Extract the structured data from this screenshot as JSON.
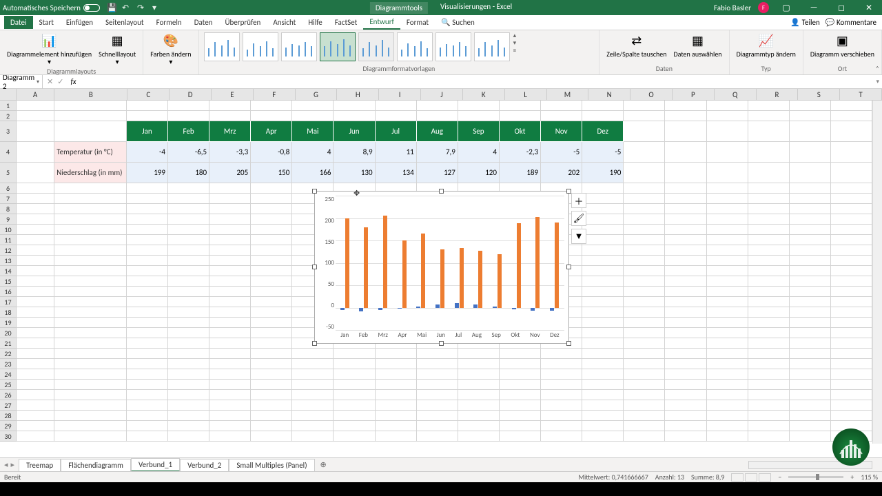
{
  "titlebar": {
    "autosave": "Automatisches Speichern",
    "app_title": "Visualisierungen - Excel",
    "tool_context": "Diagrammtools",
    "user": "Fabio Basler",
    "user_initials": "F"
  },
  "ribbon_tabs": [
    "Datei",
    "Start",
    "Einfügen",
    "Seitenlayout",
    "Formeln",
    "Daten",
    "Überprüfen",
    "Ansicht",
    "Hilfe",
    "FactSet",
    "Entwurf",
    "Format"
  ],
  "ribbon_search": "Suchen",
  "ribbon_actions": {
    "share": "Teilen",
    "comments": "Kommentare"
  },
  "ribbon": {
    "group_layouts": "Diagrammlayouts",
    "btn_add_element": "Diagrammelement hinzufügen",
    "btn_quick_layout": "Schnelllayout",
    "btn_colors": "Farben ändern",
    "group_styles": "Diagrammformatvorlagen",
    "group_data": "Daten",
    "btn_switch": "Zeile/Spalte tauschen",
    "btn_select": "Daten auswählen",
    "group_type": "Typ",
    "btn_change_type": "Diagrammtyp ändern",
    "group_location": "Ort",
    "btn_move": "Diagramm verschieben"
  },
  "namebox": "Diagramm 2",
  "columns": [
    "A",
    "B",
    "C",
    "D",
    "E",
    "F",
    "G",
    "H",
    "I",
    "J",
    "K",
    "L",
    "M",
    "N",
    "O",
    "P",
    "Q",
    "R",
    "S",
    "T"
  ],
  "months": [
    "Jan",
    "Feb",
    "Mrz",
    "Apr",
    "Mai",
    "Jun",
    "Jul",
    "Aug",
    "Sep",
    "Okt",
    "Nov",
    "Dez"
  ],
  "row_labels": {
    "temp": "Temperatur (in °C)",
    "precip": "Niederschlag (in mm)"
  },
  "temp": [
    "-4",
    "-6,5",
    "-3,3",
    "-0,8",
    "4",
    "8,9",
    "11",
    "7,9",
    "4",
    "-2,3",
    "-5",
    "-5"
  ],
  "precip": [
    "199",
    "180",
    "205",
    "150",
    "166",
    "130",
    "134",
    "127",
    "120",
    "189",
    "202",
    "190"
  ],
  "chart_data": {
    "type": "bar",
    "categories": [
      "Jan",
      "Feb",
      "Mrz",
      "Apr",
      "Mai",
      "Jun",
      "Jul",
      "Aug",
      "Sep",
      "Okt",
      "Nov",
      "Dez"
    ],
    "series": [
      {
        "name": "Temperatur (in °C)",
        "values": [
          -4,
          -6.5,
          -3.3,
          -0.8,
          4,
          8.9,
          11,
          7.9,
          4,
          -2.3,
          -5,
          -5
        ],
        "color": "#4472c4"
      },
      {
        "name": "Niederschlag (in mm)",
        "values": [
          199,
          180,
          205,
          150,
          166,
          130,
          134,
          127,
          120,
          189,
          202,
          190
        ],
        "color": "#ed7d31"
      }
    ],
    "ylim": [
      -50,
      250
    ],
    "y_ticks": [
      "250",
      "200",
      "150",
      "100",
      "50",
      "0",
      "-50"
    ]
  },
  "sheet_tabs": [
    "Treemap",
    "Flächendiagramm",
    "Verbund_1",
    "Verbund_2",
    "Small Multiples (Panel)"
  ],
  "status": {
    "ready": "Bereit",
    "avg": "Mittelwert: 0,741666667",
    "count": "Anzahl: 13",
    "sum": "Summe: 8,9",
    "zoom": "115 %"
  }
}
